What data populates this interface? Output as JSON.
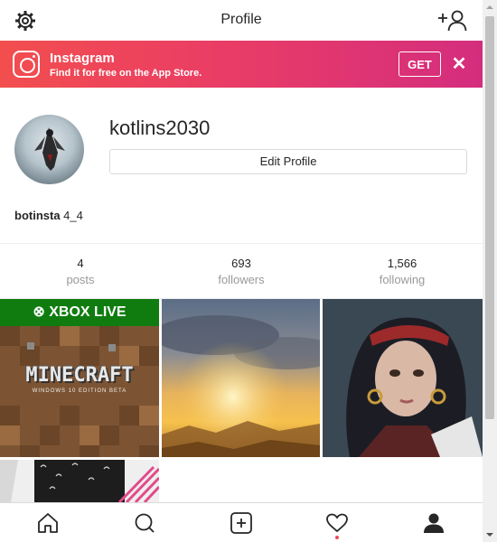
{
  "header": {
    "title": "Profile"
  },
  "banner": {
    "app_name": "Instagram",
    "subtitle": "Find it for free on the App Store.",
    "get_label": "GET",
    "close_glyph": "✕"
  },
  "profile": {
    "username": "kotlins2030",
    "edit_label": "Edit Profile",
    "bio_name": "botinsta",
    "bio_text": " 4_4"
  },
  "stats": [
    {
      "value": "4",
      "label": "posts"
    },
    {
      "value": "693",
      "label": "followers"
    },
    {
      "value": "1,566",
      "label": "following"
    }
  ],
  "posts": [
    {
      "kind": "minecraft",
      "xbox_label": "XBOX LIVE",
      "title": "MINECRAFT",
      "subtitle": "WINDOWS 10 EDITION BETA"
    },
    {
      "kind": "sunset"
    },
    {
      "kind": "portrait"
    },
    {
      "kind": "fabric"
    }
  ],
  "tabbar": {
    "items": [
      {
        "icon": "home-icon"
      },
      {
        "icon": "search-icon"
      },
      {
        "icon": "add-post-icon"
      },
      {
        "icon": "heart-icon"
      },
      {
        "icon": "profile-icon"
      }
    ]
  },
  "colors": {
    "banner_start": "#f24e4e",
    "banner_end": "#d42d7e",
    "xbox_green": "#107c10",
    "notification_dot": "#ed4956"
  }
}
